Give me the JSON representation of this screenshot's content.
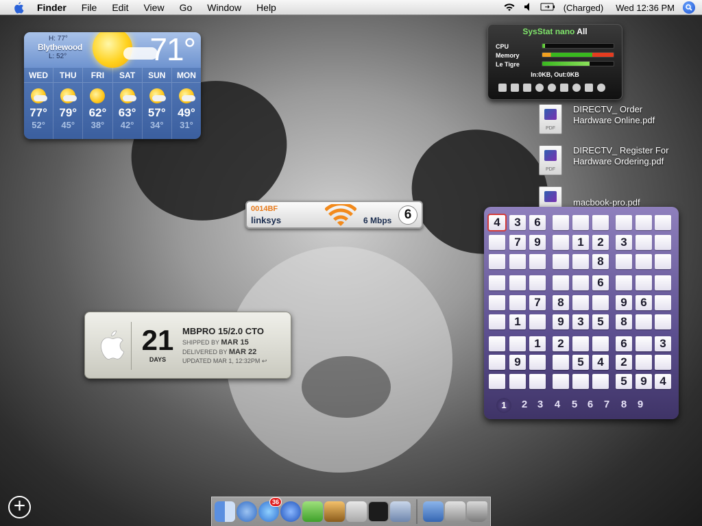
{
  "menubar": {
    "app": "Finder",
    "items": [
      "File",
      "Edit",
      "View",
      "Go",
      "Window",
      "Help"
    ],
    "battery": "(Charged)",
    "clock": "Wed 12:36 PM"
  },
  "weather": {
    "high": "H: 77°",
    "low": "L: 52°",
    "city": "Blythewood",
    "current_temp": "71°",
    "days": [
      {
        "name": "WED",
        "hi": "77°",
        "lo": "52°",
        "icon": "partly-sunny"
      },
      {
        "name": "THU",
        "hi": "79°",
        "lo": "45°",
        "icon": "partly-sunny"
      },
      {
        "name": "FRI",
        "hi": "62°",
        "lo": "38°",
        "icon": "sunny"
      },
      {
        "name": "SAT",
        "hi": "63°",
        "lo": "42°",
        "icon": "partly-sunny"
      },
      {
        "name": "SUN",
        "hi": "57°",
        "lo": "34°",
        "icon": "partly-sunny"
      },
      {
        "name": "MON",
        "hi": "49°",
        "lo": "31°",
        "icon": "partly-sunny"
      }
    ]
  },
  "sysstat": {
    "title_a": "SysStat nano",
    "title_b": "All",
    "rows": [
      {
        "label": "CPU",
        "level": 0.04
      },
      {
        "label": "Memory",
        "level": 1.0
      },
      {
        "label": "Le Tigre",
        "level": 0.66
      }
    ],
    "net": "In:0KB, Out:0KB"
  },
  "desktop_files": [
    {
      "line1": "DIRECTV_ Order",
      "line2": "Hardware Online.pdf",
      "kind": "PDF"
    },
    {
      "line1": "DIRECTV_ Register For",
      "line2": "Hardware Ordering.pdf",
      "kind": "PDF"
    },
    {
      "line1": "macbook-pro.pdf",
      "line2": "",
      "kind": "PDF"
    }
  ],
  "airport": {
    "id": "0014BF",
    "network": "linksys",
    "speed": "6 Mbps",
    "channel": "6"
  },
  "shipment": {
    "days": "21",
    "days_label": "DAYS",
    "model": "MBPRO 15/2.0 CTO",
    "shipped_label": "SHIPPED BY",
    "shipped_date": "MAR 15",
    "delivered_label": "DELIVERED BY",
    "delivered_date": "MAR 22",
    "updated": "UPDATED MAR 1, 12:32PM ↩"
  },
  "sudoku": {
    "grid": [
      [
        "4",
        "3",
        "6",
        "",
        "",
        "",
        "",
        "",
        ""
      ],
      [
        "",
        "7",
        "9",
        "",
        "1",
        "2",
        "3",
        "",
        ""
      ],
      [
        "",
        "",
        "",
        "",
        "",
        "8",
        "",
        "",
        ""
      ],
      [
        "",
        "",
        "",
        "",
        "",
        "6",
        "",
        "",
        ""
      ],
      [
        "",
        "",
        "7",
        "8",
        "",
        "",
        "9",
        "6",
        ""
      ],
      [
        "",
        "1",
        "",
        "9",
        "3",
        "5",
        "8",
        "",
        ""
      ],
      [
        "",
        "",
        "1",
        "2",
        "",
        "",
        "6",
        "",
        "3"
      ],
      [
        "",
        "9",
        "",
        "",
        "5",
        "4",
        "2",
        "",
        ""
      ],
      [
        "",
        "",
        "",
        "",
        "",
        "",
        "5",
        "9",
        "4"
      ]
    ],
    "numbers": [
      "1",
      "2",
      "3",
      "4",
      "5",
      "6",
      "7",
      "8",
      "9"
    ],
    "active_number": "1"
  },
  "dock": {
    "ical_badge": "36"
  }
}
